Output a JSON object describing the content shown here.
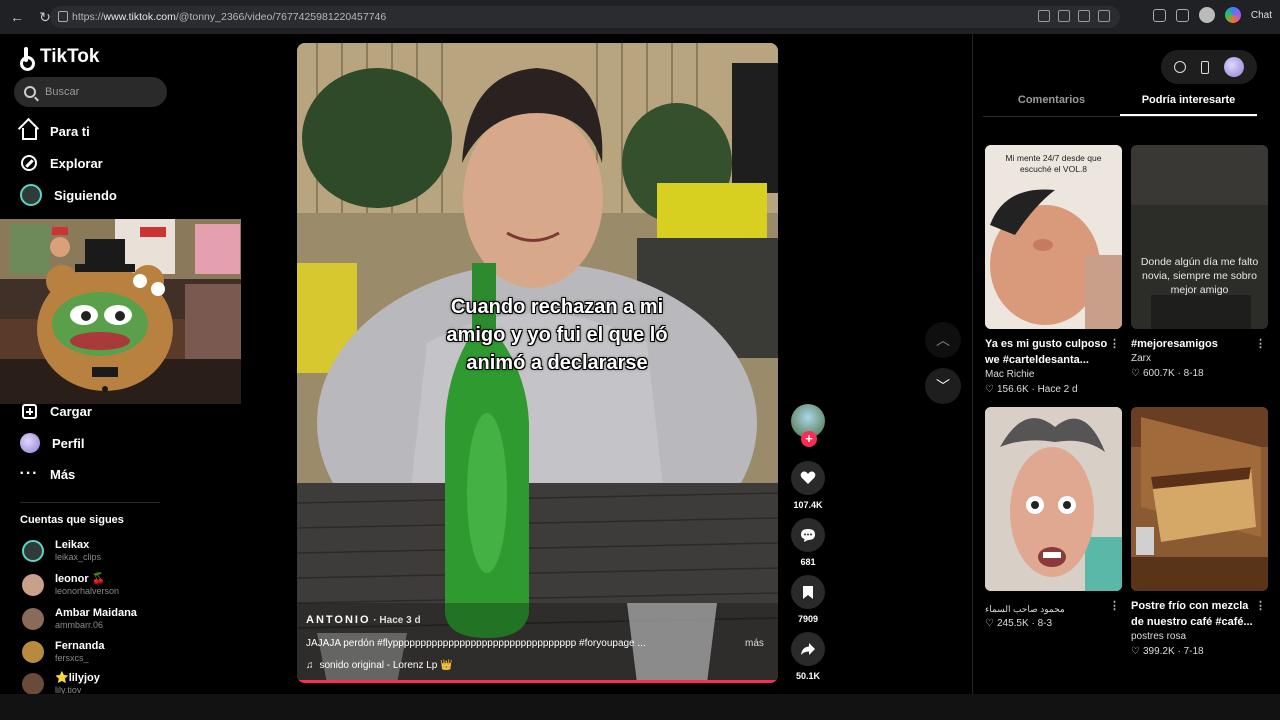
{
  "browser": {
    "url_prefix": "https://",
    "url_domain": "www.tiktok.com",
    "url_path": "/@tonny_2366/video/7677425981220457746",
    "chat_label": "Chat"
  },
  "sidebar": {
    "logo": "TikTok",
    "search_placeholder": "Buscar",
    "nav": {
      "for_you": "Para ti",
      "explore": "Explorar",
      "following": "Siguiendo",
      "upload": "Cargar",
      "profile": "Perfil",
      "more": "Más"
    },
    "follows_title": "Cuentas que sigues",
    "follows": [
      {
        "name": "Leikax",
        "handle": "leikax_clips",
        "color": "#5fd3c4"
      },
      {
        "name": "leonor 🍒",
        "handle": "leonorhalverson",
        "color": "#c9a08a"
      },
      {
        "name": "Ambar Maidana",
        "handle": "ammbarr.06",
        "color": "#8a6a5a"
      },
      {
        "name": "Fernanda",
        "handle": "fersxcs_",
        "color": "#b78a40"
      },
      {
        "name": "⭐lilyjoy",
        "handle": "lily.tiov",
        "color": "#6a4a3a"
      }
    ]
  },
  "video": {
    "overlay_text_1": "Cuando rechazan a mi",
    "overlay_text_2": "amigo y yo fui el que ló",
    "overlay_text_3": "animó a declararse",
    "author": "ANTONIO",
    "time": " · Hace 3 d",
    "description": "JAJAJA perdón #flyppppppppppppppppppppppppppppppppp #foryoupage ...",
    "more": "más",
    "sound": "sonido original - Lorenz Lp 👑",
    "progress": 1.0
  },
  "actions": {
    "likes": "107.4K",
    "comments": "681",
    "saves": "7909",
    "shares": "50.1K"
  },
  "right_panel": {
    "tabs": [
      "Comentarios",
      "Podría interesarte"
    ],
    "active_tab": 1,
    "cards": [
      {
        "thumb_text": "Mi mente 24/7 desde que escuché el VOL.8",
        "title": "Ya es mi gusto culposo we #carteldesanta...",
        "author": "Mac Richie",
        "likes": "156.6K",
        "date": "Hace 2 d"
      },
      {
        "thumb_text": "Donde algún día me falto novia, siempre me sobro mejor amigo",
        "title": "#mejoresamigos",
        "author": "Zarx",
        "likes": "600.7K",
        "date": "8-18"
      },
      {
        "thumb_text": "",
        "title": "",
        "author": "محمود صاحب السماء",
        "likes": "245.5K",
        "date": "8-3"
      },
      {
        "thumb_text": "",
        "title": "Postre frío con mezcla de nuestro café #café...",
        "author": "postres rosa",
        "likes": "399.2K",
        "date": "7-18"
      }
    ]
  },
  "colors": {
    "accent": "#fe2c55",
    "background": "#000000",
    "panel": "#1e1e1e"
  }
}
